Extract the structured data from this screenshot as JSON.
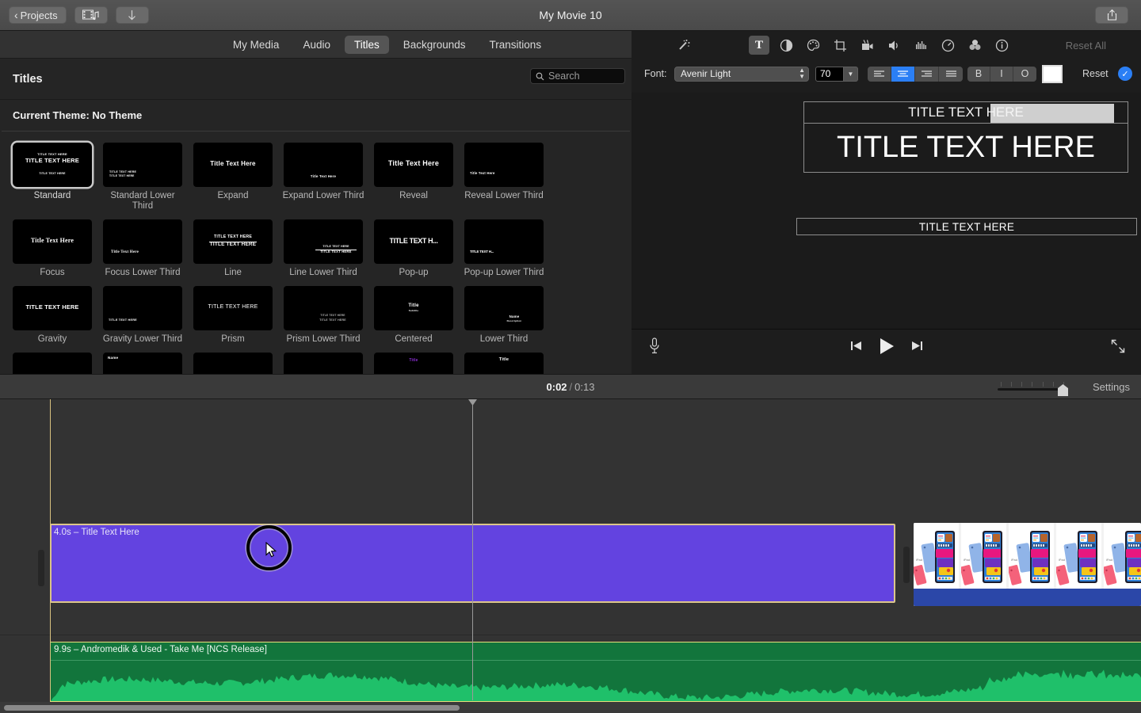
{
  "titlebar": {
    "projects_label": "Projects",
    "doc_title": "My Movie 10",
    "back_icon": "chevron-left-icon",
    "media_icon": "film-music-icon",
    "import_icon": "download-arrow-icon",
    "share_icon": "share-icon"
  },
  "browser": {
    "tabs": [
      {
        "label": "My Media",
        "active": false
      },
      {
        "label": "Audio",
        "active": false
      },
      {
        "label": "Titles",
        "active": true
      },
      {
        "label": "Backgrounds",
        "active": false
      },
      {
        "label": "Transitions",
        "active": false
      }
    ],
    "header_title": "Titles",
    "search_placeholder": "Search",
    "search_value": "",
    "search_icon": "search-icon",
    "theme_label": "Current Theme: No Theme",
    "titles": [
      {
        "label": "Standard",
        "selected": true,
        "style": "standard"
      },
      {
        "label": "Standard Lower Third",
        "selected": false,
        "style": "standard-lower"
      },
      {
        "label": "Expand",
        "selected": false,
        "style": "expand"
      },
      {
        "label": "Expand Lower Third",
        "selected": false,
        "style": "expand-lower"
      },
      {
        "label": "Reveal",
        "selected": false,
        "style": "reveal"
      },
      {
        "label": "Reveal Lower Third",
        "selected": false,
        "style": "reveal-lower"
      },
      {
        "label": "Focus",
        "selected": false,
        "style": "focus"
      },
      {
        "label": "Focus Lower Third",
        "selected": false,
        "style": "focus-lower"
      },
      {
        "label": "Line",
        "selected": false,
        "style": "line"
      },
      {
        "label": "Line Lower Third",
        "selected": false,
        "style": "line-lower"
      },
      {
        "label": "Pop-up",
        "selected": false,
        "style": "popup"
      },
      {
        "label": "Pop-up Lower Third",
        "selected": false,
        "style": "popup-lower"
      },
      {
        "label": "Gravity",
        "selected": false,
        "style": "gravity"
      },
      {
        "label": "Gravity Lower Third",
        "selected": false,
        "style": "gravity-lower"
      },
      {
        "label": "Prism",
        "selected": false,
        "style": "prism"
      },
      {
        "label": "Prism Lower Third",
        "selected": false,
        "style": "prism-lower"
      },
      {
        "label": "Centered",
        "selected": false,
        "style": "centered"
      },
      {
        "label": "Lower Third",
        "selected": false,
        "style": "lower-third"
      }
    ],
    "thumb_text": "TITLE TEXT HERE",
    "thumb_text_mixed": "Title Text Here",
    "thumb_text_short": "Title",
    "thumb_text_name": "Name",
    "thumb_text_sub": "Subtitle",
    "thumb_text_desc": "Description",
    "thumb_text_trunc": "TITLE TEXT H..."
  },
  "inspector": {
    "icons": [
      {
        "name": "magic-wand-icon",
        "active": false
      },
      {
        "name": "title-text-icon",
        "active": true
      },
      {
        "name": "color-balance-icon",
        "active": false
      },
      {
        "name": "color-correction-icon",
        "active": false
      },
      {
        "name": "crop-icon",
        "active": false
      },
      {
        "name": "stabilization-icon",
        "active": false
      },
      {
        "name": "volume-icon",
        "active": false
      },
      {
        "name": "noise-reduction-icon",
        "active": false
      },
      {
        "name": "speed-icon",
        "active": false
      },
      {
        "name": "clip-filter-icon",
        "active": false
      },
      {
        "name": "info-icon",
        "active": false
      }
    ],
    "reset_all_label": "Reset All",
    "font_label": "Font:",
    "font_value": "Avenir Light",
    "font_size": "70",
    "alignments": [
      {
        "name": "align-left",
        "active": false
      },
      {
        "name": "align-center",
        "active": true
      },
      {
        "name": "align-right",
        "active": false
      },
      {
        "name": "align-justify",
        "active": false
      }
    ],
    "styles": [
      {
        "label": "B",
        "name": "bold"
      },
      {
        "label": "I",
        "name": "italic"
      },
      {
        "label": "O",
        "name": "outline"
      }
    ],
    "color_hex": "#ffffff",
    "reset_label": "Reset",
    "apply_icon": "check-circle-icon"
  },
  "viewer": {
    "subtitle_text": "TITLE TEXT HERE",
    "main_text": "TITLE TEXT HERE",
    "lower_text": "TITLE TEXT HERE",
    "mic_icon": "microphone-icon",
    "prev_icon": "skip-back-icon",
    "play_icon": "play-icon",
    "next_icon": "skip-forward-icon",
    "fullscreen_icon": "fullscreen-icon"
  },
  "timeline_toolbar": {
    "current_time": "0:02",
    "separator": "/",
    "total_time": "0:13",
    "settings_label": "Settings",
    "zoom_value": 88
  },
  "timeline": {
    "title_clip_label": "4.0s – Title Text Here",
    "audio_clip_label": "9.9s – Andromedik & Used - Take Me [NCS Release]",
    "title_clip_color": "#6343e0",
    "title_clip_border": "#dcc68a",
    "audio_clip_color": "#12753c",
    "playhead_color": "#9a9a9a"
  },
  "chart_data": null
}
